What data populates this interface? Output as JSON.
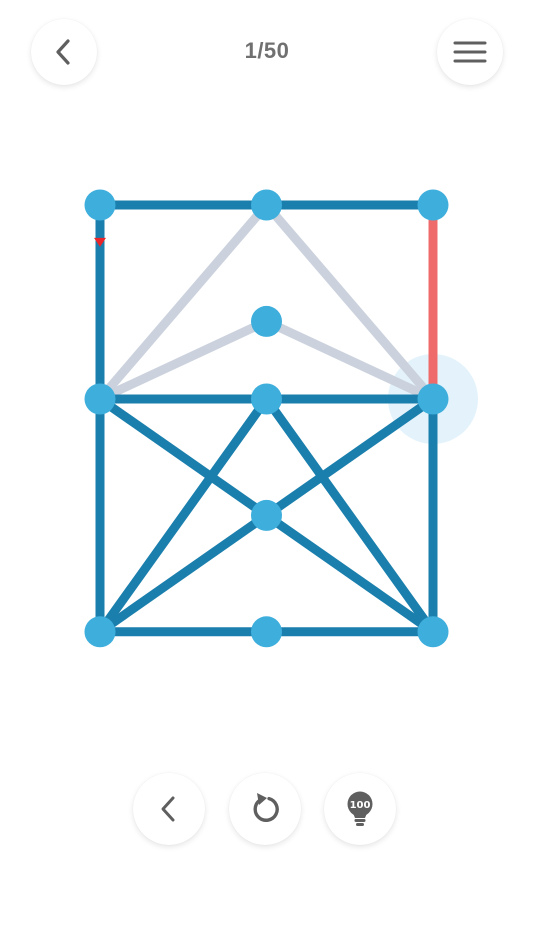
{
  "header": {
    "level_counter": "1/50"
  },
  "toolbar": {
    "hint_cost": "100"
  },
  "icons": {
    "back": "chevron-left-icon",
    "menu": "hamburger-menu-icon",
    "prev": "chevron-left-icon",
    "restart": "restart-icon",
    "hint": "lightbulb-icon"
  },
  "colors": {
    "node": "#3eaedc",
    "drawn_edge": "#1a7fad",
    "undrawn_edge": "#cbd2dd",
    "active_edge": "#ef6b6b",
    "direction_arrow": "#e8262b",
    "current_node_halo": "#e4f3fb",
    "icon_gray": "#5f5f5f"
  },
  "puzzle": {
    "nodes": [
      {
        "id": "n1",
        "col": 0,
        "row": 0
      },
      {
        "id": "n2",
        "col": 1,
        "row": 0
      },
      {
        "id": "n3",
        "col": 2,
        "row": 0
      },
      {
        "id": "n4",
        "col": 1,
        "row": 0.6
      },
      {
        "id": "n5",
        "col": 0,
        "row": 1
      },
      {
        "id": "n6",
        "col": 1,
        "row": 1
      },
      {
        "id": "n7",
        "col": 2,
        "row": 1
      },
      {
        "id": "n8",
        "col": 1,
        "row": 1.6
      },
      {
        "id": "n9",
        "col": 0,
        "row": 2.2
      },
      {
        "id": "n10",
        "col": 1,
        "row": 2.2
      },
      {
        "id": "n11",
        "col": 2,
        "row": 2.2
      }
    ],
    "current_node": "n7",
    "edges": [
      {
        "from": "n1",
        "to": "n2",
        "state": "drawn"
      },
      {
        "from": "n2",
        "to": "n3",
        "state": "drawn"
      },
      {
        "from": "n1",
        "to": "n5",
        "state": "drawn"
      },
      {
        "from": "n3",
        "to": "n7",
        "state": "active"
      },
      {
        "from": "n2",
        "to": "n5",
        "state": "undrawn"
      },
      {
        "from": "n2",
        "to": "n7",
        "state": "undrawn"
      },
      {
        "from": "n5",
        "to": "n4",
        "state": "undrawn"
      },
      {
        "from": "n4",
        "to": "n7",
        "state": "undrawn"
      },
      {
        "from": "n5",
        "to": "n6",
        "state": "drawn"
      },
      {
        "from": "n6",
        "to": "n7",
        "state": "drawn"
      },
      {
        "from": "n5",
        "to": "n9",
        "state": "drawn"
      },
      {
        "from": "n7",
        "to": "n11",
        "state": "drawn"
      },
      {
        "from": "n9",
        "to": "n10",
        "state": "drawn"
      },
      {
        "from": "n10",
        "to": "n11",
        "state": "drawn"
      },
      {
        "from": "n5",
        "to": "n8",
        "state": "drawn"
      },
      {
        "from": "n8",
        "to": "n11",
        "state": "drawn"
      },
      {
        "from": "n7",
        "to": "n8",
        "state": "drawn"
      },
      {
        "from": "n8",
        "to": "n9",
        "state": "drawn"
      },
      {
        "from": "n6",
        "to": "n9",
        "state": "drawn"
      },
      {
        "from": "n6",
        "to": "n11",
        "state": "drawn"
      }
    ],
    "start_arrow": {
      "from": "n1",
      "to": "n5",
      "direction": "down"
    }
  }
}
